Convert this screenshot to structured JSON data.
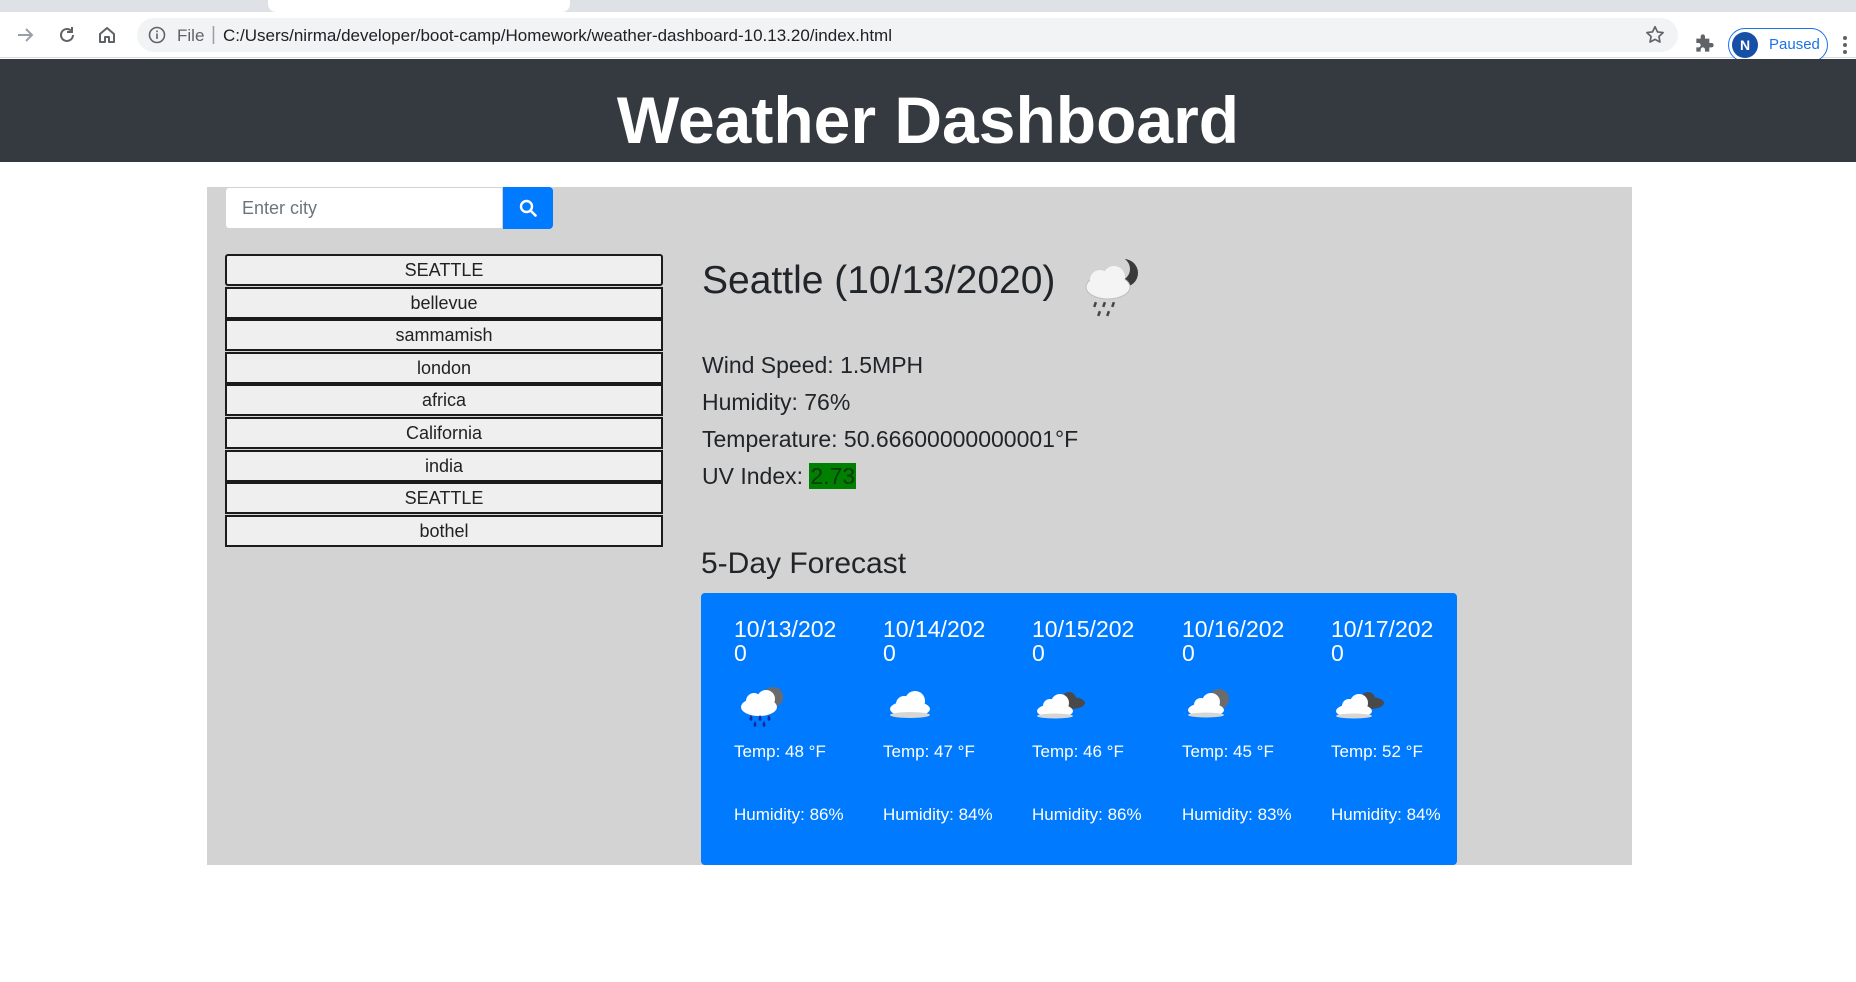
{
  "browser": {
    "scheme": "File",
    "url": "C:/Users/nirma/developer/boot-camp/Homework/weather-dashboard-10.13.20/index.html",
    "profile_initial": "N",
    "profile_status": "Paused"
  },
  "header": {
    "title": "Weather Dashboard"
  },
  "search": {
    "placeholder": "Enter city"
  },
  "history": [
    "SEATTLE",
    "bellevue",
    "sammamish",
    "london",
    "africa",
    "California",
    "india",
    "SEATTLE",
    "bothel"
  ],
  "current": {
    "title": "Seattle (10/13/2020)",
    "icon": "rain-night-icon",
    "wind": "Wind Speed: 1.5MPH",
    "humidity": "Humidity: 76%",
    "temperature": "Temperature: 50.66600000000001°F",
    "uv_label": "UV Index: ",
    "uv_value": "2.73",
    "uv_color": "#008000"
  },
  "forecast": {
    "title": "5-Day Forecast",
    "card_color": "#007bff",
    "days": [
      {
        "date": "10/13/2020",
        "icon": "rain-cloud-icon",
        "temp": "Temp: 48 °F",
        "humidity": "Humidity: 86%"
      },
      {
        "date": "10/14/2020",
        "icon": "cloud-icon",
        "temp": "Temp: 47 °F",
        "humidity": "Humidity: 84%"
      },
      {
        "date": "10/15/2020",
        "icon": "broken-clouds-icon",
        "temp": "Temp: 46 °F",
        "humidity": "Humidity: 86%"
      },
      {
        "date": "10/16/2020",
        "icon": "partly-cloudy-night-icon",
        "temp": "Temp: 45 °F",
        "humidity": "Humidity: 83%"
      },
      {
        "date": "10/17/2020",
        "icon": "broken-clouds-icon",
        "temp": "Temp: 52 °F",
        "humidity": "Humidity: 84%"
      }
    ]
  }
}
